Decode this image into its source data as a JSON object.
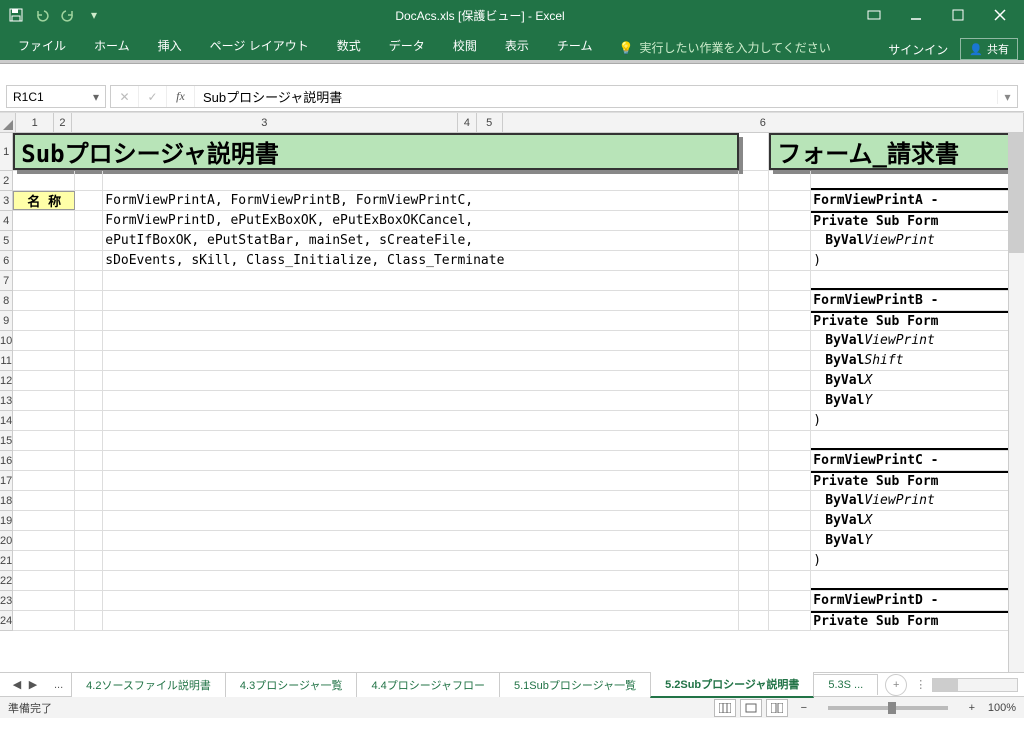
{
  "title": "DocAcs.xls  [保護ビュー] - Excel",
  "ribbon": {
    "file": "ファイル",
    "home": "ホーム",
    "insert": "挿入",
    "layout": "ページ レイアウト",
    "formula": "数式",
    "data": "データ",
    "review": "校閲",
    "view": "表示",
    "team": "チーム",
    "tell": "実行したい作業を入力してください",
    "signin": "サインイン",
    "share": "共有"
  },
  "namebox": "R1C1",
  "formula": "Subプロシージャ説明書",
  "cols": [
    "1",
    "2",
    "3",
    "4",
    "5",
    "6"
  ],
  "rows": [
    "1",
    "2",
    "3",
    "4",
    "5",
    "6",
    "7",
    "8",
    "9",
    "10",
    "11",
    "12",
    "13",
    "14",
    "15",
    "16",
    "17",
    "18",
    "19",
    "20",
    "21",
    "22",
    "23",
    "24"
  ],
  "main_title": "Subプロシージャ説明書",
  "side_title": "フォーム_請求書",
  "label_name": "名  称",
  "name_lines": [
    "FormViewPrintA, FormViewPrintB, FormViewPrintC,",
    "FormViewPrintD, ePutExBoxOK, ePutExBoxOKCancel,",
    "ePutIfBoxOK, ePutStatBar, mainSet, sCreateFile,",
    "sDoEvents, sKill, Class_Initialize, Class_Terminate"
  ],
  "right_col": {
    "r3": "FormViewPrintA -",
    "r4": "Private Sub Form",
    "r5_1": "ByVal ",
    "r5_2": "ViewPrint",
    "r6": ")",
    "r8": "FormViewPrintB -",
    "r9": "Private Sub Form",
    "r10_1": "ByVal ",
    "r10_2": "ViewPrint",
    "r11_1": "ByVal ",
    "r11_2": "Shift",
    "r12_1": "ByVal ",
    "r12_2": "X",
    "r13_1": "ByVal ",
    "r13_2": "Y",
    "r14": ")",
    "r16": "FormViewPrintC -",
    "r17": "Private Sub Form",
    "r18_1": "ByVal ",
    "r18_2": "ViewPrint",
    "r19_1": "ByVal ",
    "r19_2": "X",
    "r20_1": "ByVal ",
    "r20_2": "Y",
    "r21": ")",
    "r23": "FormViewPrintD -",
    "r24": "Private Sub Form"
  },
  "tabs": {
    "t1": "4.2ソースファイル説明書",
    "t2": "4.3プロシージャ一覧",
    "t3": "4.4プロシージャフロー",
    "t4": "5.1Subプロシージャ一覧",
    "t5": "5.2Subプロシージャ説明書",
    "t6": "5.3S  ..."
  },
  "status": "準備完了",
  "zoom": "100%"
}
